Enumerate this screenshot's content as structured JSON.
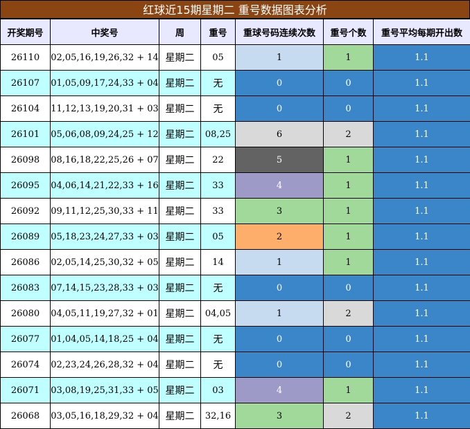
{
  "title": "红球近15期星期二 重号数据图表分析",
  "headers": [
    "开奖期号",
    "中奖号",
    "周",
    "重号",
    "重球号码连续次数",
    "重号个数",
    "重号平均每期开出数"
  ],
  "colors": {
    "c0": "#3a86c8",
    "c1": "#c6dbef",
    "c2": "#fdae6b",
    "c3": "#a1d99b",
    "c4": "#9e9ac8",
    "c5": "#636363",
    "c6": "#d9d9d9",
    "cnt0": "#3a86c8",
    "cnt1": "#a1d99b",
    "cnt2": "#d9d9d9",
    "avg": "#3a86c8"
  },
  "rows": [
    {
      "period": "26110",
      "numbers": "02,05,16,19,26,32 + 14",
      "week": "星期二",
      "repeat": "05",
      "streak": "1",
      "count": "1",
      "avg": "1.1"
    },
    {
      "period": "26107",
      "numbers": "01,05,09,17,24,33 + 04",
      "week": "星期二",
      "repeat": "无",
      "streak": "0",
      "count": "0",
      "avg": "1.1"
    },
    {
      "period": "26104",
      "numbers": "11,12,13,19,20,31 + 03",
      "week": "星期二",
      "repeat": "无",
      "streak": "0",
      "count": "0",
      "avg": "1.1"
    },
    {
      "period": "26101",
      "numbers": "05,06,08,09,24,25 + 12",
      "week": "星期二",
      "repeat": "08,25",
      "streak": "6",
      "count": "2",
      "avg": "1.1"
    },
    {
      "period": "26098",
      "numbers": "08,16,18,22,25,26 + 07",
      "week": "星期二",
      "repeat": "22",
      "streak": "5",
      "count": "1",
      "avg": "1.1"
    },
    {
      "period": "26095",
      "numbers": "04,06,14,21,22,33 + 16",
      "week": "星期二",
      "repeat": "33",
      "streak": "4",
      "count": "1",
      "avg": "1.1"
    },
    {
      "period": "26092",
      "numbers": "09,11,12,25,30,33 + 11",
      "week": "星期二",
      "repeat": "33",
      "streak": "3",
      "count": "1",
      "avg": "1.1"
    },
    {
      "period": "26089",
      "numbers": "05,18,23,24,27,33 + 03",
      "week": "星期二",
      "repeat": "05",
      "streak": "2",
      "count": "1",
      "avg": "1.1"
    },
    {
      "period": "26086",
      "numbers": "02,05,14,25,30,32 + 05",
      "week": "星期二",
      "repeat": "14",
      "streak": "1",
      "count": "1",
      "avg": "1.1"
    },
    {
      "period": "26083",
      "numbers": "07,14,15,23,28,33 + 03",
      "week": "星期二",
      "repeat": "无",
      "streak": "0",
      "count": "0",
      "avg": "1.1"
    },
    {
      "period": "26080",
      "numbers": "04,05,11,19,27,32 + 01",
      "week": "星期二",
      "repeat": "04,05",
      "streak": "1",
      "count": "2",
      "avg": "1.1"
    },
    {
      "period": "26077",
      "numbers": "01,04,05,14,18,25 + 04",
      "week": "星期二",
      "repeat": "无",
      "streak": "0",
      "count": "0",
      "avg": "1.1"
    },
    {
      "period": "26074",
      "numbers": "02,23,24,26,28,32 + 04",
      "week": "星期二",
      "repeat": "无",
      "streak": "0",
      "count": "0",
      "avg": "1.1"
    },
    {
      "period": "26071",
      "numbers": "03,08,19,25,31,33 + 05",
      "week": "星期二",
      "repeat": "03",
      "streak": "4",
      "count": "1",
      "avg": "1.1"
    },
    {
      "period": "26068",
      "numbers": "03,05,16,18,29,32 + 04",
      "week": "星期二",
      "repeat": "32,16",
      "streak": "3",
      "count": "2",
      "avg": "1.1"
    }
  ]
}
